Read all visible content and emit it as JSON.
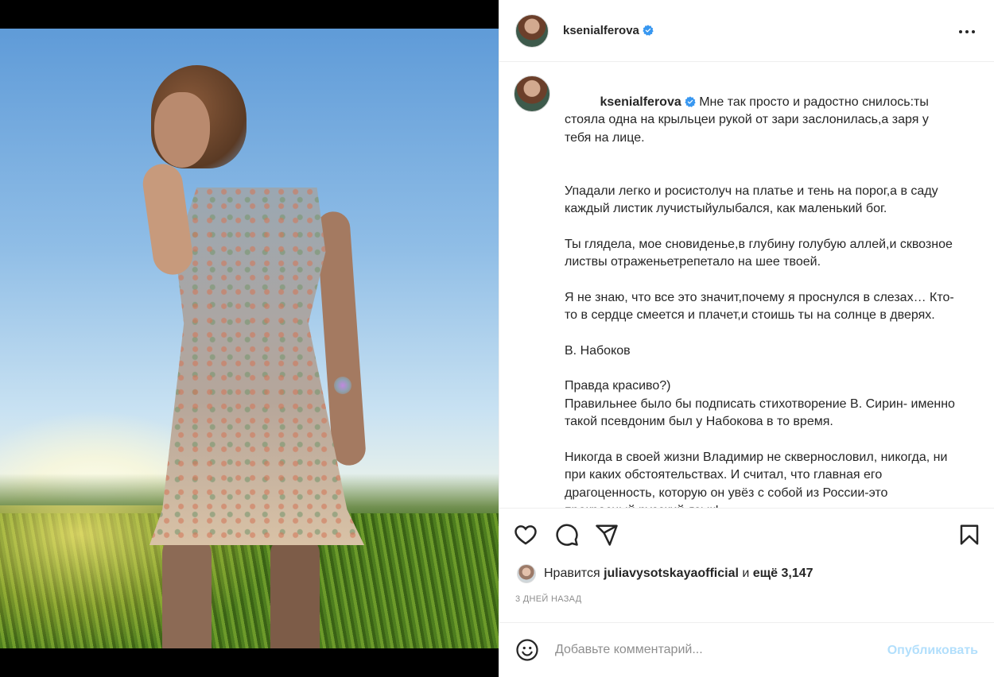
{
  "post": {
    "username": "ksenialferova",
    "verified": true,
    "verified_icon": "verified-badge-icon",
    "more_icon": "more-options-icon",
    "photo_description_icon": "post-photo"
  },
  "caption": {
    "username": "ksenialferova",
    "first_paragraph": "Мне так просто и радостно снилось:ты стояла одна на крыльцеи рукой от зари заслонилась,а заря у тебя на лице.",
    "paragraphs": [
      "Упадали легко и росистолуч на платье и тень на порог,а в саду каждый листик лучистыйулыбался, как маленький бог.",
      "Ты глядела, мое сновиденье,в глубину голубую аллей,и сквозное листвы отраженьетрепетало на шее твоей.",
      "Я не знаю, что все это значит,почему я проснулся в слезах… Кто-то в сердце смеется и плачет,и стоишь ты на солнце в дверях.",
      "В. Набоков",
      "Правда красиво?)\nПравильнее было бы подписать стихотворение В. Сирин- именно такой псевдоним был у Набокова в то время.",
      "Никогда в своей жизни Владимир не сквернословил, никогда, ни при каких обстоятельствах. И считал, что главная его драгоценность, которую он увёз с собой из России-это прекрасный русский язык!"
    ]
  },
  "actions": {
    "like_icon": "heart-icon",
    "comment_icon": "comment-icon",
    "share_icon": "share-icon",
    "save_icon": "bookmark-icon"
  },
  "likes": {
    "prefix": "Нравится",
    "user": "juliavysotskayaofficial",
    "connector": "и",
    "others": "ещё 3,147"
  },
  "timestamp": "3 дней назад",
  "comment": {
    "emoji_icon": "emoji-icon",
    "placeholder": "Добавьте комментарий...",
    "post_label": "Опубликовать"
  },
  "colors": {
    "verified_blue": "#3897f0",
    "post_button_disabled": "#b2dffc",
    "secondary_text": "#8e8e8e",
    "border": "#efefef"
  }
}
